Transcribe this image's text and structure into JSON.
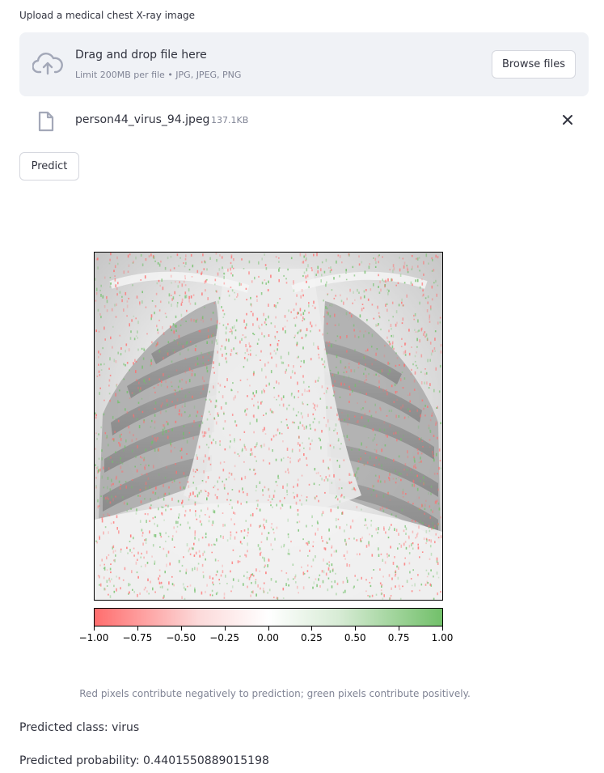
{
  "uploader": {
    "label": "Upload a medical chest X-ray image",
    "drop_title": "Drag and drop file here",
    "limit_text": "Limit 200MB per file • JPG, JPEG, PNG",
    "browse_label": "Browse files"
  },
  "uploaded_file": {
    "name": "person44_virus_94.jpeg",
    "size": "137.1KB"
  },
  "predict_label": "Predict",
  "explanation": {
    "colorbar_ticks": [
      "−1.00",
      "−0.75",
      "−0.50",
      "−0.25",
      "0.00",
      "0.25",
      "0.50",
      "0.75",
      "1.00"
    ],
    "negative_color": "#ff6e6e",
    "positive_color": "#72c06a",
    "caption": "Red pixels contribute negatively to prediction; green pixels contribute positively."
  },
  "results": {
    "class_text": "Predicted class: virus",
    "probability_text": "Predicted probability: 0.4401550889015198"
  }
}
